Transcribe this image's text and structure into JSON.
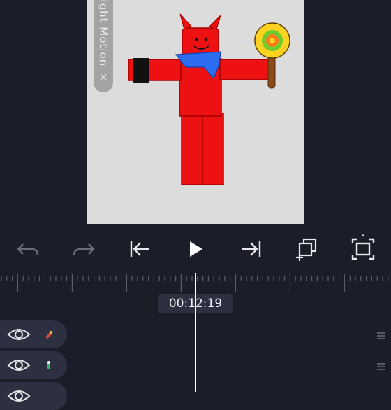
{
  "preview": {
    "watermark_text": "Alight Motion ×"
  },
  "toolbar": {
    "buttons": [
      {
        "name": "undo-icon",
        "enabled": false
      },
      {
        "name": "redo-icon",
        "enabled": false
      },
      {
        "name": "skip-to-start-icon",
        "enabled": true
      },
      {
        "name": "play-icon",
        "enabled": true
      },
      {
        "name": "skip-to-end-icon",
        "enabled": true
      },
      {
        "name": "duplicate-add-icon",
        "enabled": true
      },
      {
        "name": "fit-to-screen-icon",
        "enabled": true
      }
    ]
  },
  "timeline": {
    "timecode": "00:12:19",
    "layers": [
      {
        "name": "layer-1",
        "visible": true,
        "thumb_color": "#d94b3a"
      },
      {
        "name": "layer-2",
        "visible": true,
        "thumb_color": "#3bb36a"
      },
      {
        "name": "layer-3",
        "visible": true,
        "thumb_color": "#cccccc"
      }
    ]
  },
  "colors": {
    "background": "#1b1e28",
    "panel": "#2c3040",
    "accent_white": "#ffffff",
    "disabled_icon": "#6a6e7a"
  }
}
